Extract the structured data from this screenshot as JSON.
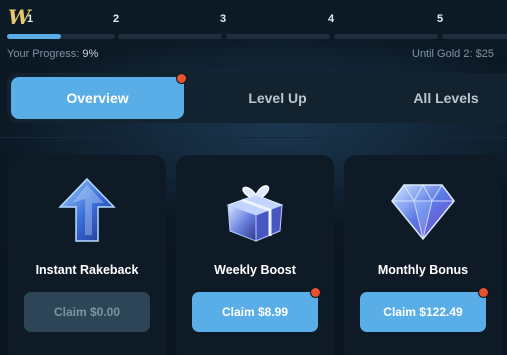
{
  "progress": {
    "steps": [
      "1",
      "2",
      "3",
      "4",
      "5"
    ],
    "percent": 9,
    "progress_label": "Your Progress:",
    "progress_value": "9%",
    "next_tier_text": "Until Gold 2: $25"
  },
  "tabs": [
    {
      "label": "Overview",
      "active": true
    },
    {
      "label": "Level Up",
      "active": false
    },
    {
      "label": "All Levels",
      "active": false
    }
  ],
  "cards": [
    {
      "title": "Instant Rakeback",
      "claim_label": "Claim $0.00",
      "enabled": false,
      "icon": "arrow-up-icon",
      "has_notification": false
    },
    {
      "title": "Weekly Boost",
      "claim_label": "Claim $8.99",
      "enabled": true,
      "icon": "gift-box-icon",
      "has_notification": true
    },
    {
      "title": "Monthly Bonus",
      "claim_label": "Claim $122.49",
      "enabled": true,
      "icon": "diamond-icon",
      "has_notification": true
    }
  ],
  "colors": {
    "accent": "#5aaee8",
    "notification": "#e8522c",
    "logo_gold": "#e8c86a",
    "background": "#0b1824"
  },
  "logo_text": "W"
}
